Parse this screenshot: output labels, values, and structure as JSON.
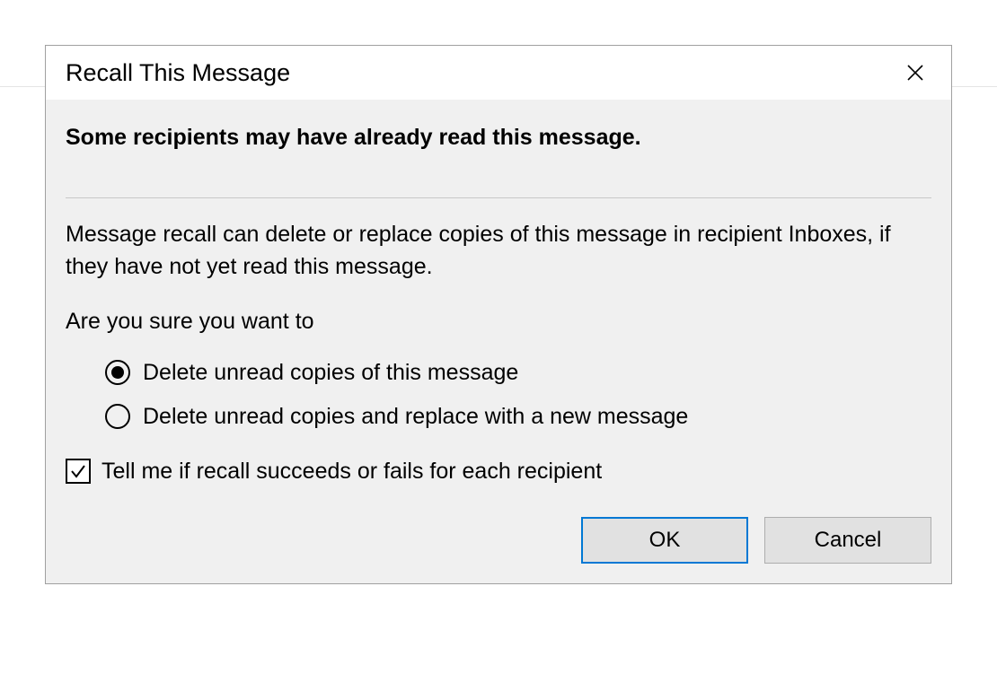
{
  "dialog": {
    "title": "Recall This Message",
    "warning": "Some recipients may have already read this message.",
    "description": "Message recall can delete or replace copies of this message in recipient Inboxes, if they have not yet read this message.",
    "prompt": "Are you sure you want to",
    "options": {
      "delete": "Delete unread copies of this message",
      "replace": "Delete unread copies and replace with a new message",
      "selected": "delete"
    },
    "checkbox": {
      "label": "Tell me if recall succeeds or fails for each recipient",
      "checked": true
    },
    "buttons": {
      "ok": "OK",
      "cancel": "Cancel"
    }
  }
}
